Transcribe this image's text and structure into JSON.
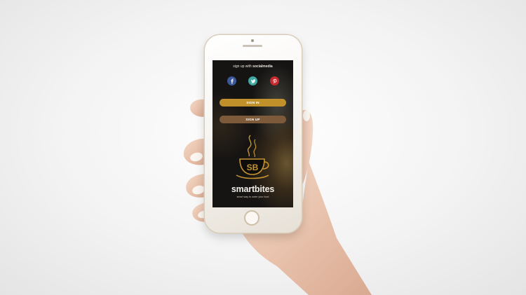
{
  "screen": {
    "title_prefix": "sign up with",
    "title_bold": "socialmedia",
    "social_icons": [
      "facebook-icon",
      "twitter-icon",
      "pinterest-icon"
    ],
    "signin_label": "SIGN IN",
    "signup_label": "SIGN UP",
    "brand_name": "smartbites",
    "tagline": "smart way to order your food",
    "logo_monogram": "SB"
  },
  "colors": {
    "signin": "#c0912a",
    "signup": "#7c5a3a",
    "facebook": "#3b5998",
    "twitter": "#3fa7a2",
    "pinterest": "#c62a2f",
    "gold": "#c49433"
  }
}
